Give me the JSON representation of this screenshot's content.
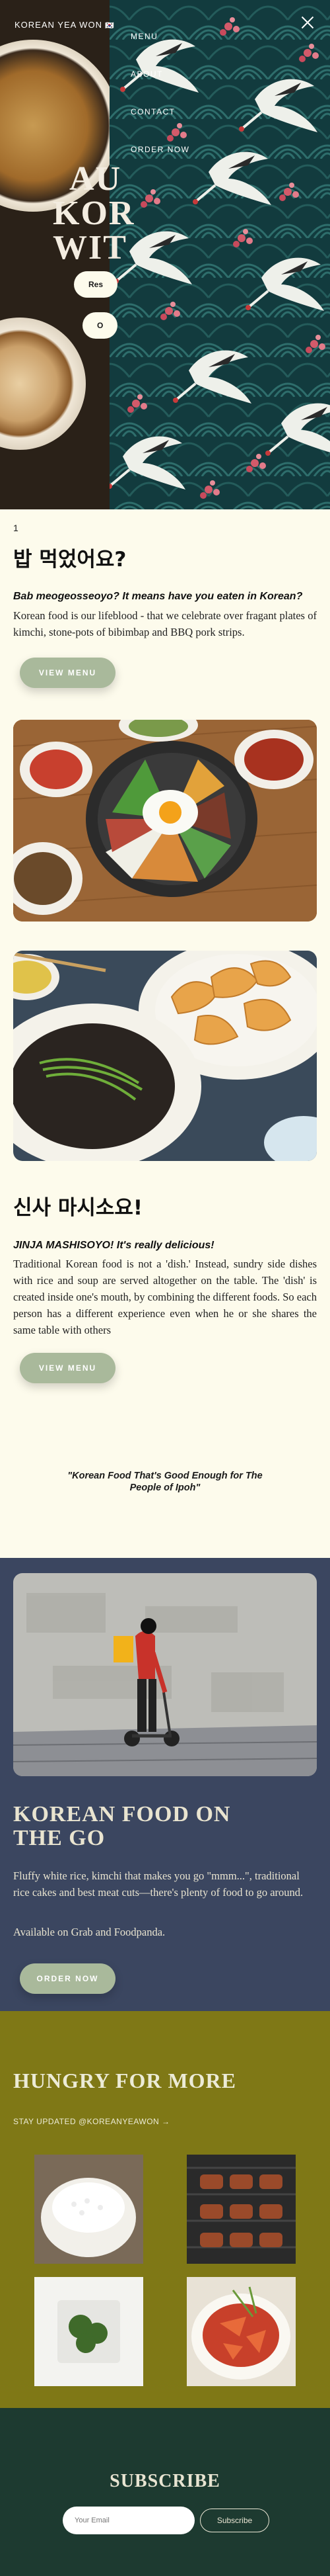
{
  "header": {
    "brand": "KOREAN YEA WON",
    "flag": "🇰🇷"
  },
  "hero": {
    "title_lines": [
      "AU",
      "KOR",
      "WIT"
    ],
    "btn1": "Res",
    "btn2": "O"
  },
  "menu": {
    "items": [
      "MENU",
      "ABOUT",
      "CONTACT",
      "ORDER NOW"
    ],
    "close_icon": "close-icon"
  },
  "intro": {
    "number": "1",
    "heading": "밥 먹었어요?",
    "lead": "Bab meogeosseoyo? It means have you eaten in Korean?",
    "body": "Korean food is our lifeblood - that we celebrate over fragant plates of kimchi, stone-pots of bibimbap and BBQ pork strips.",
    "button": "VIEW MENU"
  },
  "second": {
    "heading": "신사 마시소요!",
    "lead": "JINJA MASHISOYO! It's really delicious!",
    "body": "Traditional Korean food is not a 'dish.' Instead, sundry side dishes with rice and soup are served altogether on the table. The 'dish' is created inside one's mouth, by combining the different foods. So each person has a different experience even when he or she shares the same table with others",
    "button": "VIEW MENU"
  },
  "quote": "\"Korean Food That's Good Enough for The People of Ipoh\"",
  "go": {
    "heading_lines": [
      "KOREAN FOOD ON",
      "THE GO"
    ],
    "para1": "Fluffy white rice, kimchi that makes you go \"mmm...\", traditional rice cakes and best meat cuts—there's plenty of food to go around.",
    "para2": "Available on Grab and Foodpanda.",
    "button": "ORDER NOW"
  },
  "hungry": {
    "heading": "HUNGRY FOR MORE",
    "updated": "STAY UPDATED @KOREANYEAWON →"
  },
  "subscribe": {
    "heading": "SUBSCRIBE",
    "placeholder": "Your Email",
    "button": "Subscribe"
  },
  "colors": {
    "cream": "#fdfbec",
    "sage": "#a9b99b",
    "navy": "#3b4660",
    "olive": "#7f7816",
    "forest": "#1d3a30",
    "teal": "#123b3e"
  }
}
